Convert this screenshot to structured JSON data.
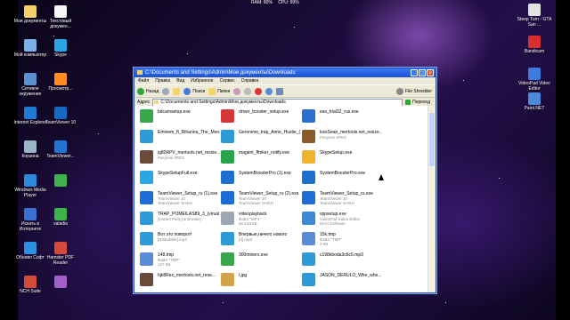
{
  "top_status": {
    "ram": "RAM: 80%",
    "cpu": "CPU: 99%"
  },
  "desktop_left": [
    {
      "label": "Мои документы",
      "color": "#f4d06a"
    },
    {
      "label": "Текстовый докумен...",
      "color": "#f6f6f6"
    },
    {
      "label": "Мой компьютер",
      "color": "#7bb0e8"
    },
    {
      "label": "Skype",
      "color": "#2aa6e5"
    },
    {
      "label": "Сетевое окружение",
      "color": "#5a8fd0"
    },
    {
      "label": "Просмотр...",
      "color": "#ff8b21"
    },
    {
      "label": "Internet Explorer",
      "color": "#1e7ad6"
    },
    {
      "label": "TeamViewer 10",
      "color": "#1469c4"
    },
    {
      "label": "Корзина",
      "color": "#9ab6c8"
    },
    {
      "label": "TeamViewer...",
      "color": "#2176d1"
    },
    {
      "label": "Windows Media Player",
      "color": "#2b8bd8"
    },
    {
      "label": "",
      "color": "#3db34a"
    },
    {
      "label": "Искать в Интернете",
      "color": "#3a6fcf"
    },
    {
      "label": "valadia",
      "color": "#3cb44a"
    },
    {
      "label": "Обновл Софт",
      "color": "#2d8fe0"
    },
    {
      "label": "Hamster PDF Reader",
      "color": "#d44a3a"
    },
    {
      "label": "NCH Suite",
      "color": "#d24a3a"
    },
    {
      "label": "",
      "color": "#a25ec9"
    }
  ],
  "desktop_right": [
    {
      "label": "Steep Turn - GTA San ...",
      "color": "#e2e2e2"
    },
    {
      "label": "Bandicam",
      "color": "#d72f2f"
    },
    {
      "label": "VideoPad Video Editor",
      "color": "#3c7ae0"
    },
    {
      "label": "Paint.NET",
      "color": "#4b8ad8"
    }
  ],
  "window": {
    "title": "C:\\Documents and Settings\\Admin\\Мои документы\\Downloads",
    "menu": [
      "Файл",
      "Правка",
      "Вид",
      "Избранное",
      "Сервис",
      "Справка"
    ],
    "toolbar": {
      "back": "Назад",
      "search": "Поиск",
      "folders": "Папки",
      "shredder": "File Shredder"
    },
    "address_label": "Адрес",
    "address": "C:\\Documents and Settings\\Admin\\Мои документы\\Downloads",
    "go": "Переход"
  },
  "files": [
    {
      "name": "bdcamsetup.exe",
      "sub": "",
      "sub2": "",
      "icon": "#38a74b"
    },
    {
      "name": "driver_booster_setup.exe",
      "sub": "",
      "sub2": "",
      "icon": "#d9363a"
    },
    {
      "name": "eav_trial32_rus.exe",
      "sub": "",
      "sub2": "",
      "icon": "#2c6ed0"
    },
    {
      "name": "Eminem_ft_Rihanna_The_Mon...",
      "sub": "",
      "sub2": "",
      "icon": "#2e9ad8"
    },
    {
      "name": "Geronimo_trap_Anne_Hustle_(...",
      "sub": "",
      "sub2": "",
      "icon": "#2e9ad8"
    },
    {
      "name": "kissSean_mertools.net_resize...",
      "sub": "Рисунок JPEG",
      "sub2": "",
      "icon": "#8b5a2b"
    },
    {
      "name": "ig80RPV_mertools.net_resize...",
      "sub": "Рисунок JPEG",
      "sub2": "",
      "icon": "#6b4a3b"
    },
    {
      "name": "magent_ffmker_notify.exe",
      "sub": "",
      "sub2": "",
      "icon": "#2aa34a"
    },
    {
      "name": "SkypeSetup.exe",
      "sub": "",
      "sub2": "",
      "icon": "#f0b42c"
    },
    {
      "name": "SkypeSetupFull.exe",
      "sub": "",
      "sub2": "",
      "icon": "#2aa6e5"
    },
    {
      "name": "SystemBoosterPro (1).exe",
      "sub": "",
      "sub2": "",
      "icon": "#1e6fd0"
    },
    {
      "name": "SystemBoosterPro.exe",
      "sub": "",
      "sub2": "",
      "icon": "#1e6fd0"
    },
    {
      "name": "TeamViewer_Setup_ru (1).exe",
      "sub": "TeamViewer 10",
      "sub2": "TeamViewer GmbH",
      "icon": "#1c6dd6"
    },
    {
      "name": "TeamViewer_Setup_ru (2).exe",
      "sub": "TeamViewer 10",
      "sub2": "TeamViewer GmbH",
      "icon": "#1c6dd6"
    },
    {
      "name": "TeamViewer_Setup_ru.exe",
      "sub": "TeamViewer 10",
      "sub2": "TeamViewer GmbH",
      "icon": "#1c6dd6"
    },
    {
      "name": "TRAP_POMEILAS89_3_(virual...",
      "sub": "[Instant Party] & Breaks)",
      "sub2": "",
      "icon": "#2e9ad8"
    },
    {
      "name": "videoplayback",
      "sub": "Файл \"MP4\"",
      "sub2": "40 519 КБ",
      "icon": "#9ea6b4"
    },
    {
      "name": "vppsetup.exe",
      "sub": "VideoPad Video Editor",
      "sub2": "NCH Software",
      "icon": "#3b8ad8"
    },
    {
      "name": "Вот это поворот!",
      "sub": "[Ribbubble].mp4",
      "sub2": "",
      "icon": "#2e9ad8"
    },
    {
      "name": "Впервые,ничего нового",
      "sub": "[3].mp3",
      "sub2": "",
      "icon": "#2e9ad8"
    },
    {
      "name": "15k.tmp",
      "sub": "Файл \"TMP\"",
      "sub2": "3 КБ",
      "icon": "#5a8ad8"
    },
    {
      "name": "148.tmp",
      "sub": "Файл \"TMP\"",
      "sub2": "127 КБ",
      "icon": "#5a8ad8"
    },
    {
      "name": "300miners.exe",
      "sub": "",
      "sub2": "",
      "icon": "#3aa54a"
    },
    {
      "name": "c198kboda3c6c5.mp3",
      "sub": "",
      "sub2": "",
      "icon": "#2e9ad8"
    },
    {
      "name": "hjk8Rec_mertools.net_rese...",
      "sub": "",
      "sub2": "",
      "icon": "#6b4a3b"
    },
    {
      "name": "l.jpg",
      "sub": "",
      "sub2": "",
      "icon": "#d4a24a"
    },
    {
      "name": "JASON_DERULO_Whe_whe...",
      "sub": "",
      "sub2": "",
      "icon": "#2e9ad8"
    }
  ]
}
